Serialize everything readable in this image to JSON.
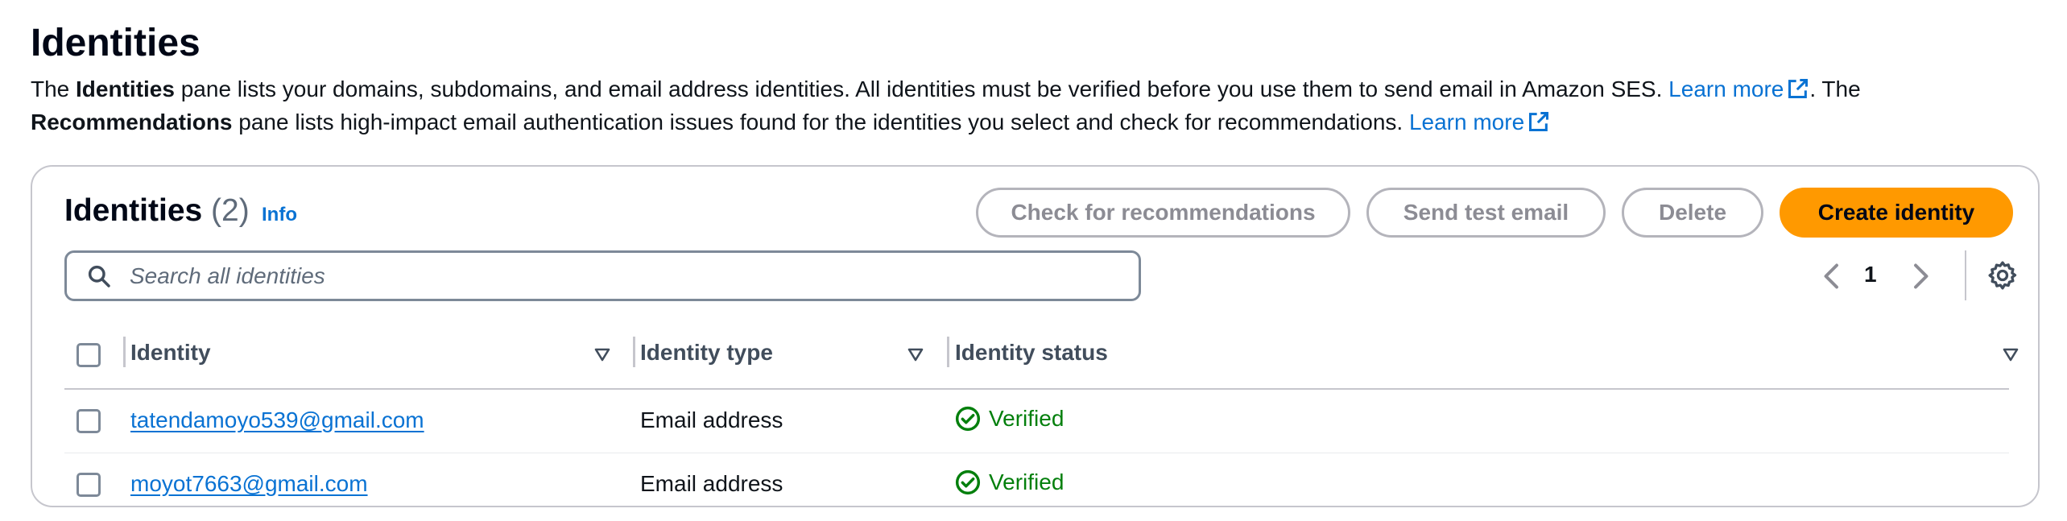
{
  "page": {
    "title": "Identities",
    "description": {
      "p1": "The ",
      "b1": "Identities",
      "p2": " pane lists your domains, subdomains, and email address identities. All identities must be verified before you use them to send email in Amazon SES. ",
      "learn_more_1": "Learn more",
      "p3": ". The",
      "b2": "Recommendations",
      "p4": " pane lists high-impact email authentication issues found for the identities you select and check for recommendations. ",
      "learn_more_2": "Learn more"
    }
  },
  "panel": {
    "title": "Identities",
    "count": "(2)",
    "info_link": "Info",
    "buttons": {
      "check_recommendations": "Check for recommendations",
      "send_test_email": "Send test email",
      "delete": "Delete",
      "create_identity": "Create identity"
    },
    "search": {
      "placeholder": "Search all identities",
      "icon": "search-icon"
    },
    "pagination": {
      "current_page": "1"
    },
    "settings_icon": "gear-icon",
    "columns": [
      "Identity",
      "Identity type",
      "Identity status"
    ],
    "rows": [
      {
        "identity": "tatendamoyo539@gmail.com",
        "type": "Email address",
        "status": "Verified"
      },
      {
        "identity": "moyot7663@gmail.com",
        "type": "Email address",
        "status": "Verified"
      }
    ]
  },
  "colors": {
    "primary_button": "#ff9900",
    "link": "#0972d3",
    "success": "#037f0c",
    "disabled_text": "#8c8c94"
  }
}
